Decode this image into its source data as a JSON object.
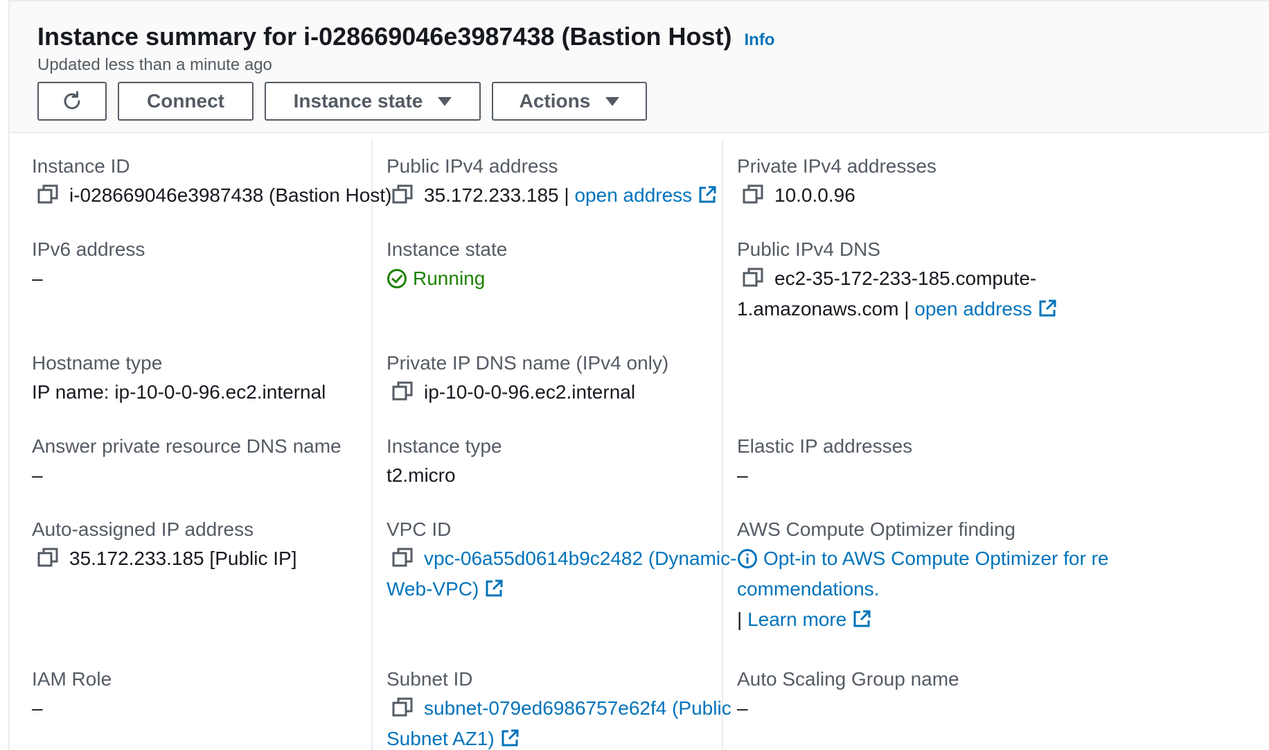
{
  "header": {
    "title": "Instance summary for i-028669046e3987438 (Bastion Host)",
    "info_link": "Info",
    "updated": "Updated less than a minute ago"
  },
  "toolbar": {
    "connect_label": "Connect",
    "instance_state_label": "Instance state",
    "actions_label": "Actions"
  },
  "fields": {
    "instance_id": {
      "label": "Instance ID",
      "value": "i-028669046e3987438 (Bastion Host)"
    },
    "public_ipv4": {
      "label": "Public IPv4 address",
      "value": "35.172.233.185",
      "separator": " | ",
      "link": "open address"
    },
    "private_ipv4": {
      "label": "Private IPv4 addresses",
      "value": "10.0.0.96"
    },
    "ipv6": {
      "label": "IPv6 address",
      "value": "–"
    },
    "instance_state": {
      "label": "Instance state",
      "value": "Running"
    },
    "public_dns": {
      "label": "Public IPv4 DNS",
      "value_line1": "ec2-35-172-233-185.compute-",
      "value_line2": "1.amazonaws.com",
      "separator": " | ",
      "link": "open address"
    },
    "hostname_type": {
      "label": "Hostname type",
      "value": "IP name: ip-10-0-0-96.ec2.internal"
    },
    "private_dns": {
      "label": "Private IP DNS name (IPv4 only)",
      "value": "ip-10-0-0-96.ec2.internal"
    },
    "answer_dns": {
      "label": "Answer private resource DNS name",
      "value": "–"
    },
    "instance_type": {
      "label": "Instance type",
      "value": "t2.micro"
    },
    "elastic_ip": {
      "label": "Elastic IP addresses",
      "value": "–"
    },
    "auto_ip": {
      "label": "Auto-assigned IP address",
      "value": "35.172.233.185 [Public IP]"
    },
    "vpc_id": {
      "label": "VPC ID",
      "value_line1": "vpc-06a55d0614b9c2482 (Dynamic-",
      "value_line2": "Web-VPC)"
    },
    "optimizer": {
      "label": "AWS Compute Optimizer finding",
      "link_line1": "Opt-in to AWS Compute Optimizer for re",
      "link_line2": "commendations.",
      "separator": "| ",
      "learn_more": "Learn more"
    },
    "iam_role": {
      "label": "IAM Role",
      "value": "–"
    },
    "subnet_id": {
      "label": "Subnet ID",
      "value_line1": "subnet-079ed6986757e62f4 (Public",
      "value_line2": "Subnet AZ1)"
    },
    "asg_name": {
      "label": "Auto Scaling Group name",
      "value": "–"
    }
  },
  "colors": {
    "link": "#0073bb",
    "running": "#1d8102",
    "label": "#545b64",
    "text": "#16191f"
  },
  "icons": {
    "copy": "copy-icon",
    "external": "external-link-icon",
    "refresh": "refresh-icon",
    "running": "check-circle-icon",
    "info": "info-circle-icon",
    "caret": "caret-down-icon"
  }
}
